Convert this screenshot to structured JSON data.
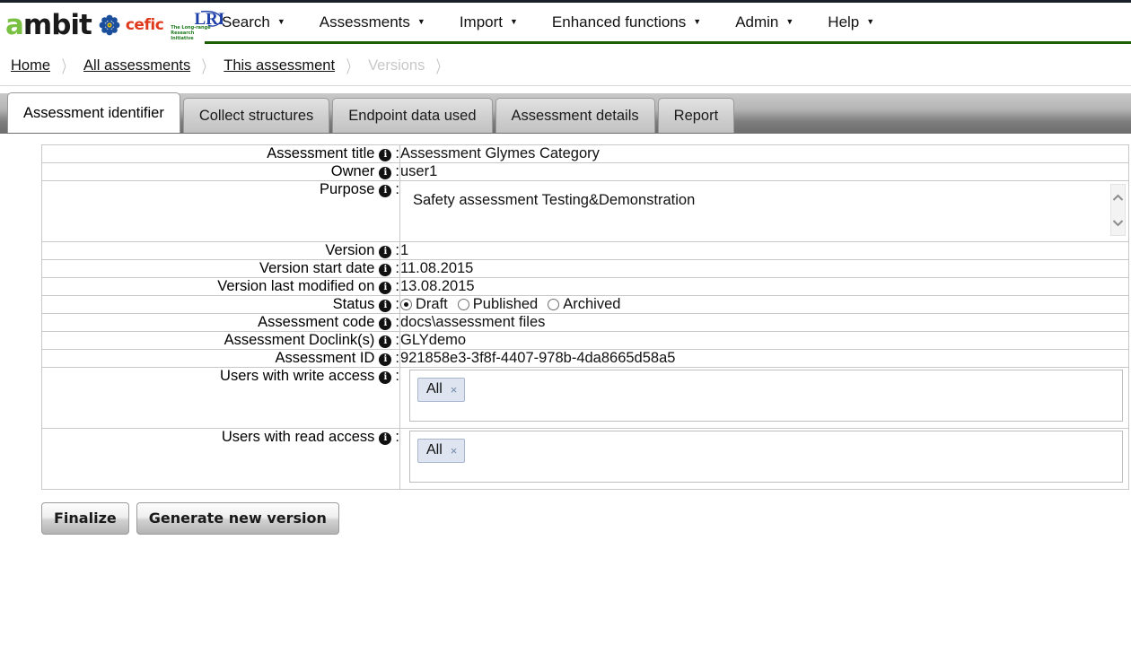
{
  "brand": {
    "ambit_part1": "a",
    "ambit_part2": "mbit",
    "cefic": "cefic",
    "lri": "LRI",
    "lri_sub": "The Long-range Research Initiative"
  },
  "nav": {
    "items": [
      {
        "label": "Search",
        "caret": "▼"
      },
      {
        "label": "Assessments",
        "caret": "▼"
      },
      {
        "label": "Import",
        "caret": "▼"
      },
      {
        "label": "Enhanced functions",
        "caret": "▼"
      },
      {
        "label": "Admin",
        "caret": "▼"
      },
      {
        "label": "Help",
        "caret": "▼"
      }
    ]
  },
  "breadcrumb": {
    "sep": "〉",
    "items": [
      {
        "label": "Home",
        "disabled": false
      },
      {
        "label": "All assessments",
        "disabled": false
      },
      {
        "label": "This assessment",
        "disabled": false
      },
      {
        "label": "Versions",
        "disabled": true
      }
    ]
  },
  "tabs": [
    {
      "label": "Assessment identifier",
      "active": true
    },
    {
      "label": "Collect structures",
      "active": false
    },
    {
      "label": "Endpoint data used",
      "active": false
    },
    {
      "label": "Assessment details",
      "active": false
    },
    {
      "label": "Report",
      "active": false
    }
  ],
  "form": {
    "info_glyph": "i",
    "colon": ":",
    "rows": {
      "title": {
        "label": "Assessment title",
        "value": "Assessment Glymes Category"
      },
      "owner": {
        "label": "Owner",
        "value": "user1"
      },
      "purpose": {
        "label": "Purpose",
        "value": "Safety assessment Testing&Demonstration"
      },
      "version": {
        "label": "Version",
        "value": "1"
      },
      "version_start": {
        "label": "Version start date",
        "value": "11.08.2015"
      },
      "version_modified": {
        "label": "Version last modified on",
        "value": "13.08.2015"
      },
      "status": {
        "label": "Status"
      },
      "code": {
        "label": "Assessment code",
        "value": "docs\\assessment files"
      },
      "doclink": {
        "label": "Assessment Doclink(s)",
        "value": "GLYdemo"
      },
      "id": {
        "label": "Assessment ID",
        "value": "921858e3-3f8f-4407-978b-4da8665d58a5"
      },
      "write_access": {
        "label": "Users with write access",
        "tag": "All",
        "tag_x": "×"
      },
      "read_access": {
        "label": "Users with read access",
        "tag": "All",
        "tag_x": "×"
      }
    },
    "status_options": [
      {
        "label": "Draft",
        "checked": true
      },
      {
        "label": "Published",
        "checked": false
      },
      {
        "label": "Archived",
        "checked": false
      }
    ]
  },
  "buttons": {
    "finalize": "Finalize",
    "generate": "Generate new version"
  },
  "colors": {
    "nav_underline": "#1d6003",
    "ambit_green": "#7ac143",
    "cefic_red": "#e03a1e",
    "lri_blue": "#1f3fa8",
    "tag_bg": "#dee5f0"
  }
}
